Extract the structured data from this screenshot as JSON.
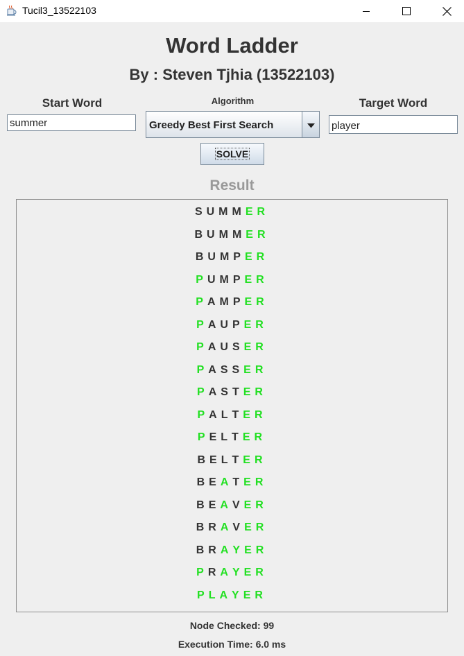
{
  "window": {
    "title": "Tucil3_13522103",
    "icon": "java-cup-icon",
    "controls": [
      "minimize-icon",
      "maximize-icon",
      "close-icon"
    ]
  },
  "header": {
    "title": "Word Ladder",
    "subtitle": "By : Steven Tjhia (13522103)"
  },
  "form": {
    "start_label": "Start Word",
    "start_value": "summer",
    "algorithm_label": "Algorithm",
    "algorithm_value": "Greedy Best First Search",
    "target_label": "Target Word",
    "target_value": "player",
    "solve_label": "SOLVE"
  },
  "result": {
    "label": "Result",
    "target": "PLAYER",
    "words": [
      "SUMMER",
      "BUMMER",
      "BUMPER",
      "PUMPER",
      "PAMPER",
      "PAUPER",
      "PAUSER",
      "PASSER",
      "PASTER",
      "PALTER",
      "PELTER",
      "BELTER",
      "BEATER",
      "BEAVER",
      "BRAVER",
      "BRAYER",
      "PRAYER",
      "PLAYER"
    ]
  },
  "stats": {
    "nodes_text": "Node Checked: 99",
    "time_text": "Execution Time: 6.0 ms"
  },
  "colors": {
    "match": "#22e022",
    "default": "#333333"
  }
}
